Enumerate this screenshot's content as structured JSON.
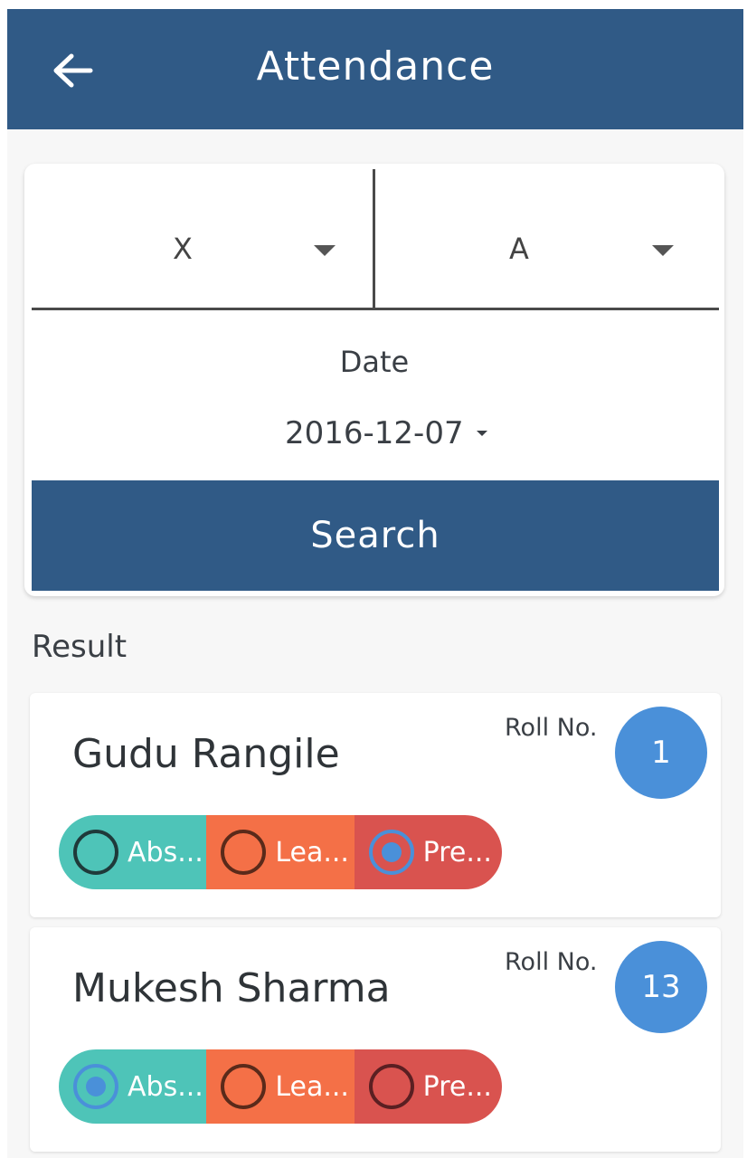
{
  "app_bar": {
    "title": "Attendance",
    "back_icon": "arrow-left-icon",
    "color": "#305a86"
  },
  "filters": {
    "class_value": "X",
    "section_value": "A",
    "date_label": "Date",
    "date_value": "2016-12-07",
    "search_label": "Search"
  },
  "result_label": "Result",
  "students": [
    {
      "name": "Gudu Rangile",
      "roll_label": "Roll No.",
      "roll_number": "1",
      "options": [
        {
          "label": "Abs...",
          "checked": false
        },
        {
          "label": "Lea...",
          "checked": false
        },
        {
          "label": "Pre...",
          "checked": true
        }
      ]
    },
    {
      "name": "Mukesh Sharma",
      "roll_label": "Roll No.",
      "roll_number": "13",
      "options": [
        {
          "label": "Abs...",
          "checked": true
        },
        {
          "label": "Lea...",
          "checked": false
        },
        {
          "label": "Pre...",
          "checked": false
        }
      ]
    }
  ],
  "colors": {
    "absent": "#4ec4b8",
    "leave": "#f47047",
    "present": "#d9534f",
    "roll_badge": "#4a90d9"
  }
}
